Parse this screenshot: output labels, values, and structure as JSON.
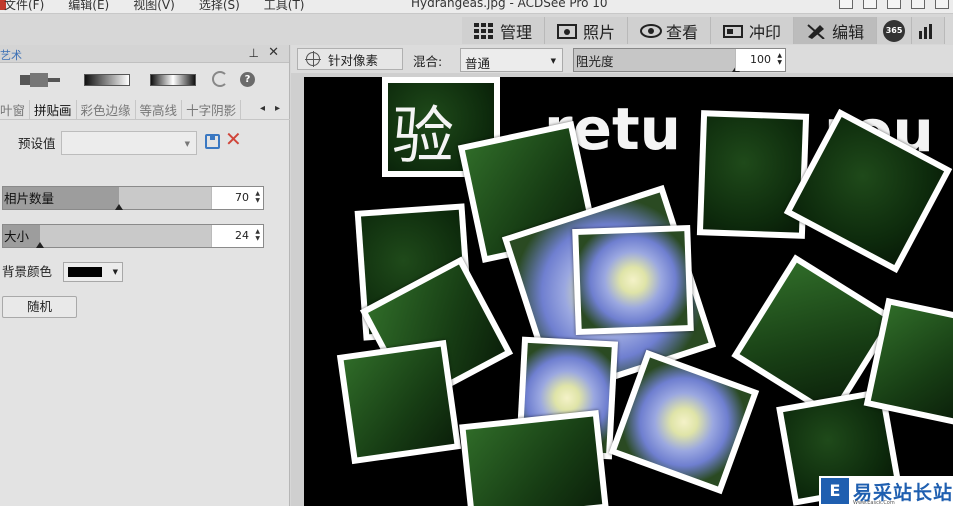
{
  "window": {
    "title": "Hydrangeas.jpg - ACDSee Pro 10",
    "menu": [
      "文件(F)",
      "编辑(E)",
      "视图(V)",
      "选择(S)",
      "工具(T)"
    ]
  },
  "modes": [
    {
      "label": "管理",
      "icon": "grid-icon",
      "active": false
    },
    {
      "label": "照片",
      "icon": "photos-icon",
      "active": false
    },
    {
      "label": "查看",
      "icon": "eye-icon",
      "active": false
    },
    {
      "label": "冲印",
      "icon": "develop-icon",
      "active": false
    },
    {
      "label": "编辑",
      "icon": "edit-icon",
      "active": true
    },
    {
      "label": "365",
      "icon": "acdsee365-icon",
      "active": false
    }
  ],
  "panel": {
    "title": "艺术",
    "tabs": [
      "叶窗",
      "拼贴画",
      "彩色边缘",
      "等高线",
      "十字阴影"
    ],
    "active_tab": "拼贴画",
    "preset_label": "预设值",
    "preset_value": "",
    "photo_count": {
      "label": "相片数量",
      "value": "70",
      "level": 0.56
    },
    "size": {
      "label": "大小",
      "value": "24",
      "level": 0.18
    },
    "bg_color": {
      "label": "背景颜色",
      "value": "#000000"
    },
    "random_button": "随机"
  },
  "image_toolbar": {
    "pixel_target_label": "针对像素",
    "blend_label": "混合:",
    "blend_value": "普通",
    "opacity": {
      "label": "阻光度",
      "value": "100",
      "level": 1.0
    }
  },
  "canvas": {
    "overlay_text_1": "验",
    "overlay_text_2": "retu",
    "overlay_text_3": "rou",
    "watermark": "易采站长站",
    "watermark_url": "Www.Easck.Com"
  },
  "colors": {
    "accent": "#3a78c2",
    "danger": "#d0453a",
    "watermark": "#1f5fb0"
  }
}
